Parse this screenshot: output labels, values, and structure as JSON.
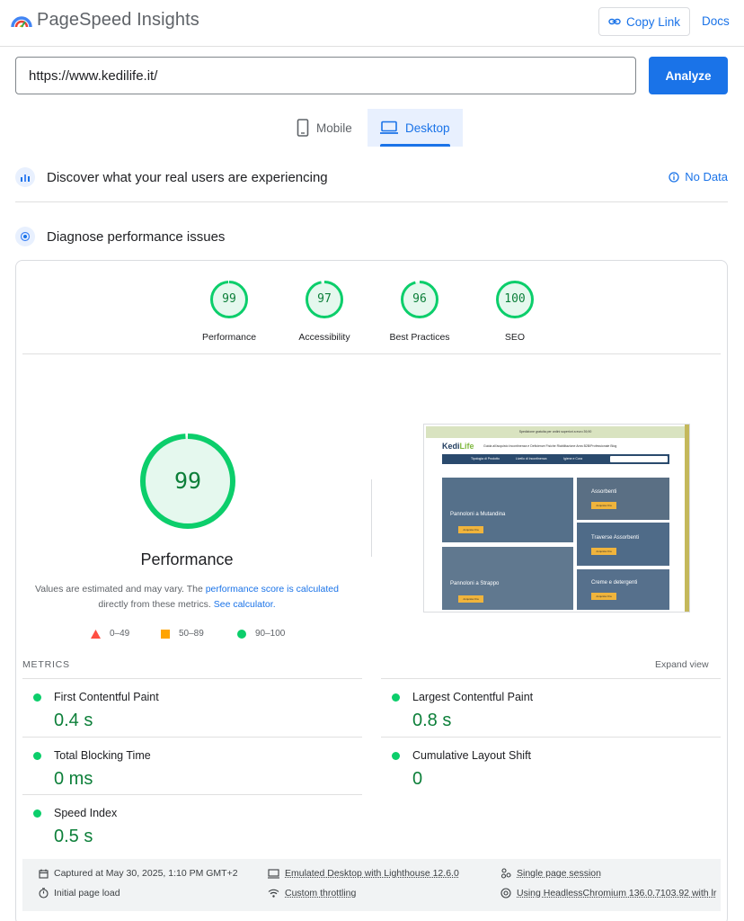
{
  "app": {
    "title": "PageSpeed Insights"
  },
  "header": {
    "copy_link_label": "Copy Link",
    "docs_label": "Docs"
  },
  "url_bar": {
    "value": "https://www.kedilife.it/",
    "analyze_label": "Analyze"
  },
  "tabs": [
    {
      "label": "Mobile",
      "selected": false
    },
    {
      "label": "Desktop",
      "selected": true
    }
  ],
  "real_users": {
    "title": "Discover what your real users are experiencing",
    "status": "No Data"
  },
  "diagnose": {
    "title": "Diagnose performance issues"
  },
  "scores": [
    {
      "label": "Performance",
      "value": "99",
      "fraction": 0.99
    },
    {
      "label": "Accessibility",
      "value": "97",
      "fraction": 0.97
    },
    {
      "label": "Best Practices",
      "value": "96",
      "fraction": 0.96
    },
    {
      "label": "SEO",
      "value": "100",
      "fraction": 1.0
    }
  ],
  "main_score": {
    "value": "99",
    "fraction": 0.99,
    "label": "Performance",
    "note_prefix": "Values are estimated and may vary. The ",
    "note_link": "performance score is calculated",
    "note_mid": "directly from these metrics. ",
    "note_link2": "See calculator."
  },
  "legend": [
    {
      "range": "0–49",
      "color": "#ff4e42",
      "shape": "triangle"
    },
    {
      "range": "50–89",
      "color": "#ffa400",
      "shape": "square"
    },
    {
      "range": "90–100",
      "color": "#0cce6b",
      "shape": "circle"
    }
  ],
  "thumbnail": {
    "banner": "Spedizione gratuita per ordini superiori a euro 39,90",
    "logo_a": "Kedi",
    "logo_b": "Life",
    "menu": "Guida all'acquisto   Incontinenza e Deficienze Fisiche   Riabilitazione   Area B2B/Professionale   Blog",
    "nav": [
      "Tipologia di Prodotto",
      "Livello di Incontinenza",
      "Igiene e Cura"
    ],
    "tiles": [
      "Pannoloni a Mutandina",
      "Assorbenti",
      "Traverse Assorbenti",
      "Pannoloni a Strappo",
      "Creme e detergenti"
    ],
    "button": "Acquista Ora"
  },
  "metrics": {
    "heading": "METRICS",
    "expand_label": "Expand view",
    "items": [
      {
        "label": "First Contentful Paint",
        "value": "0.4 s"
      },
      {
        "label": "Largest Contentful Paint",
        "value": "0.8 s"
      },
      {
        "label": "Total Blocking Time",
        "value": "0 ms"
      },
      {
        "label": "Cumulative Layout Shift",
        "value": "0"
      },
      {
        "label": "Speed Index",
        "value": "0.5 s"
      }
    ]
  },
  "footer": {
    "captured": "Captured at May 30, 2025, 1:10 PM GMT+2",
    "initial_load": "Initial page load",
    "emulated": "Emulated Desktop with Lighthouse 12.6.0",
    "throttling": "Custom throttling",
    "session": "Single page session",
    "browser": "Using HeadlessChromium 136.0.7103.92 with lr"
  },
  "colors": {
    "accent": "#1a73e8",
    "pass": "#0cce6b",
    "pass_text": "#0c7f39",
    "pass_fill": "#e5f8ee"
  }
}
